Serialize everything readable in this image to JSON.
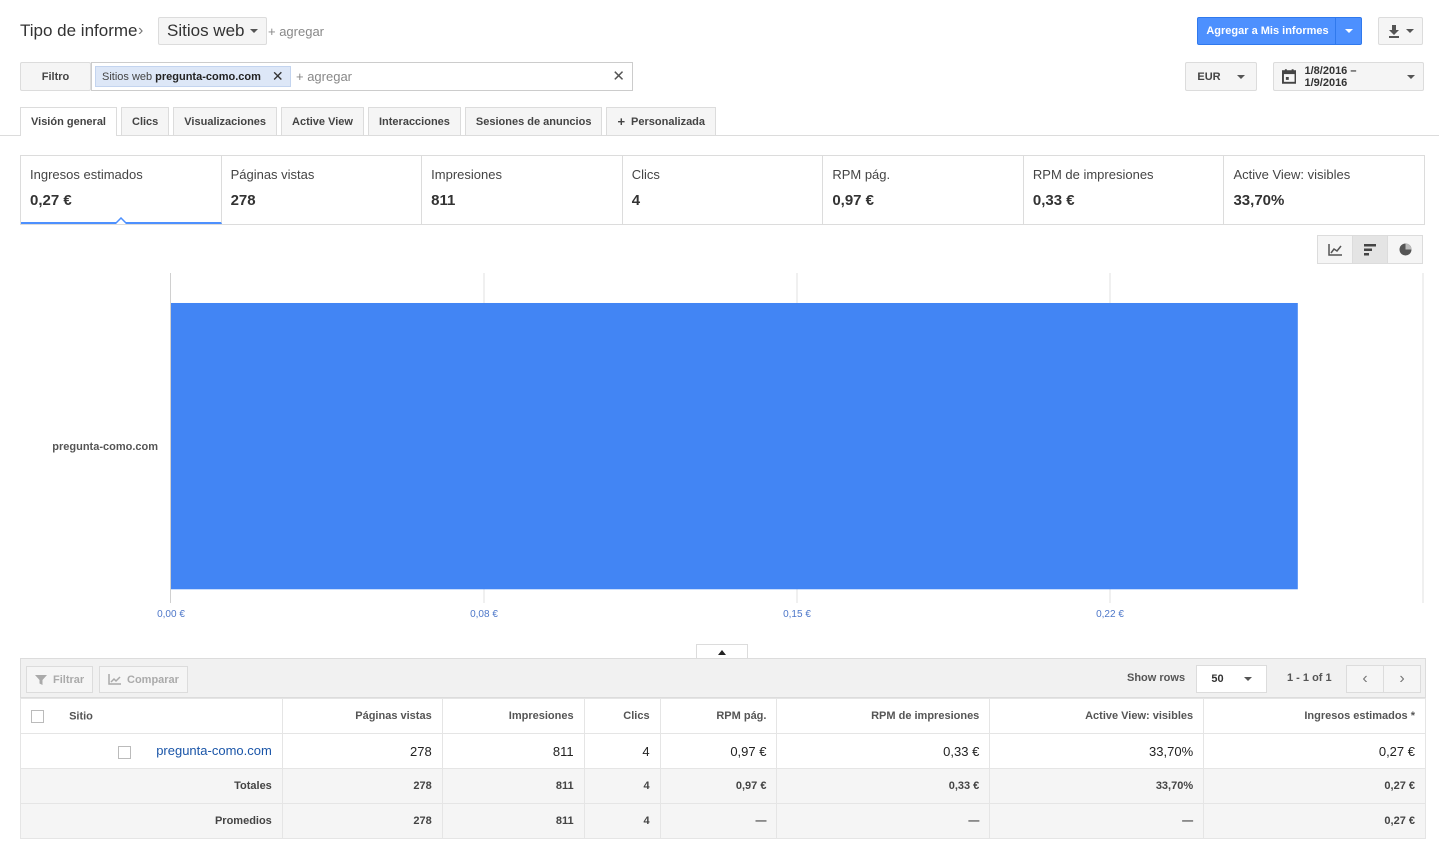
{
  "header": {
    "report_type_label": "Tipo de informe",
    "report_type_value": "Sitios web",
    "add_label": "+ agregar",
    "add_to_reports_label": "Agregar a Mis informes"
  },
  "filter": {
    "button_label": "Filtro",
    "chip_prefix": "Sitios web",
    "chip_value": "pregunta-como.com",
    "add_placeholder": "+ agregar"
  },
  "currency": "EUR",
  "date_range": "1/8/2016 – 1/9/2016",
  "tabs": [
    {
      "label": "Visión general",
      "active": true
    },
    {
      "label": "Clics"
    },
    {
      "label": "Visualizaciones"
    },
    {
      "label": "Active View"
    },
    {
      "label": "Interacciones"
    },
    {
      "label": "Sesiones de anuncios"
    },
    {
      "label": "Personalizada"
    }
  ],
  "scorecards": [
    {
      "name": "Ingresos estimados",
      "value": "0,27 €"
    },
    {
      "name": "Páginas vistas",
      "value": "278"
    },
    {
      "name": "Impresiones",
      "value": "811"
    },
    {
      "name": "Clics",
      "value": "4"
    },
    {
      "name": "RPM pág.",
      "value": "0,97 €"
    },
    {
      "name": "RPM de impresiones",
      "value": "0,33 €"
    },
    {
      "name": "Active View: visibles",
      "value": "33,70%"
    }
  ],
  "chart_data": {
    "type": "bar",
    "orientation": "horizontal",
    "categories": [
      "pregunta-como.com"
    ],
    "values": [
      0.27
    ],
    "x_ticks": [
      "0,00 €",
      "0,08 €",
      "0,15 €",
      "0,22 €"
    ],
    "x_tick_values": [
      0,
      0.075,
      0.15,
      0.225
    ],
    "xlim": [
      0,
      0.3
    ],
    "grid": true,
    "bar_color": "#4285f4"
  },
  "table": {
    "filter_label": "Filtrar",
    "compare_label": "Comparar",
    "show_rows_label": "Show rows",
    "rows_value": "50",
    "page_info": "1 - 1 of 1",
    "headers": [
      "Sitio",
      "Páginas vistas",
      "Impresiones",
      "Clics",
      "RPM pág.",
      "RPM de impresiones",
      "Active View: visibles",
      "Ingresos estimados *"
    ],
    "row": [
      "pregunta-como.com",
      "278",
      "811",
      "4",
      "0,97 €",
      "0,33 €",
      "33,70%",
      "0,27 €"
    ],
    "totals": [
      "Totales",
      "278",
      "811",
      "4",
      "0,97 €",
      "0,33 €",
      "33,70%",
      "0,27 €"
    ],
    "averages": [
      "Promedios",
      "278",
      "811",
      "4",
      "—",
      "—",
      "—",
      "0,27 €"
    ]
  },
  "colors": {
    "accent": "#4d90fe",
    "bar": "#4285f4",
    "link": "#1a55a8"
  }
}
